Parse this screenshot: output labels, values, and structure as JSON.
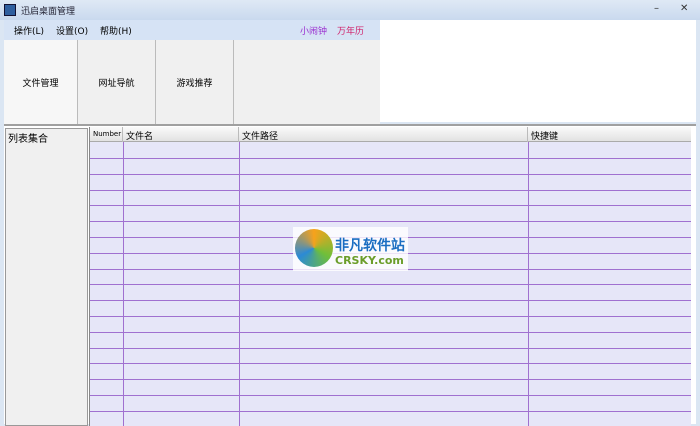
{
  "window": {
    "title": "迅启桌面管理",
    "minimize": "–",
    "close": "✕"
  },
  "menu": [
    "操作(L)",
    "设置(O)",
    "帮助(H)"
  ],
  "links": {
    "alarm": "小闹钟",
    "calendar": "万年历",
    "alarm_color": "#9b30d0",
    "calendar_color": "#d0206a"
  },
  "tabs": [
    {
      "label": "文件管理",
      "active": true
    },
    {
      "label": "网址导航",
      "active": false
    },
    {
      "label": "游戏推荐",
      "active": false
    }
  ],
  "left_list": {
    "header": "列表集合"
  },
  "table": {
    "columns": [
      "Number",
      "文件名",
      "文件路径",
      "快捷键"
    ],
    "rows": []
  },
  "watermark": {
    "name": "非凡软件站",
    "domain": "CRSKY.com"
  }
}
